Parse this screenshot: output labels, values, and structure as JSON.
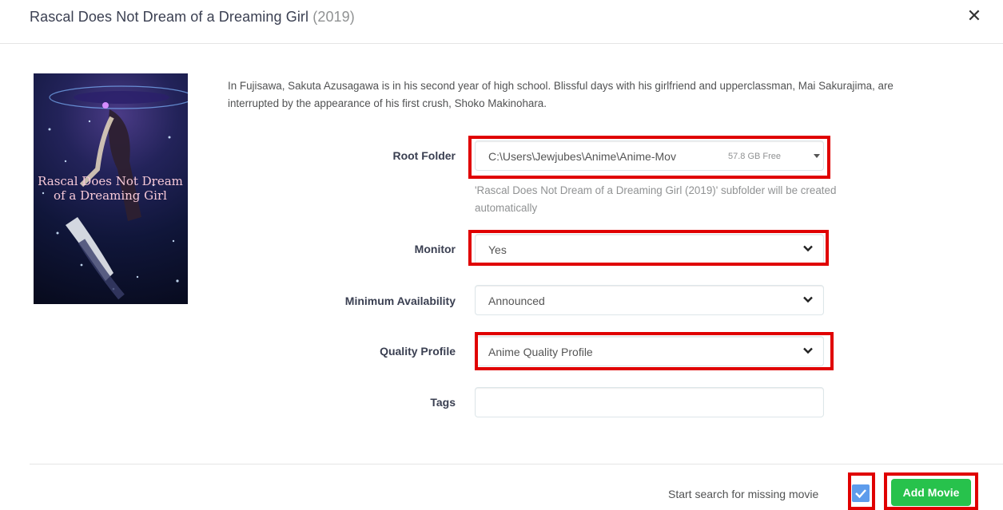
{
  "modal": {
    "title": "Rascal Does Not Dream of a Dreaming Girl",
    "year": "(2019)",
    "close_icon": "close-icon"
  },
  "poster": {
    "alt_title_art": "Rascal Does Not Dream of a Dreaming Girl"
  },
  "overview": "In Fujisawa, Sakuta Azusagawa is in his second year of high school. Blissful days with his girlfriend and upperclassman, Mai Sakurajima, are interrupted by the appearance of his first crush, Shoko Makinohara.",
  "form": {
    "root_folder": {
      "label": "Root Folder",
      "value": "C:\\Users\\Jewjubes\\Anime\\Anime-Mov",
      "free_space": "57.8 GB Free",
      "help": "'Rascal Does Not Dream of a Dreaming Girl (2019)' subfolder will be created automatically"
    },
    "monitor": {
      "label": "Monitor",
      "value": "Yes"
    },
    "minimum_availability": {
      "label": "Minimum Availability",
      "value": "Announced"
    },
    "quality_profile": {
      "label": "Quality Profile",
      "value": "Anime Quality Profile"
    },
    "tags": {
      "label": "Tags",
      "value": ""
    }
  },
  "footer": {
    "search_label": "Start search for missing movie",
    "search_checked": true,
    "add_button": "Add Movie"
  },
  "colors": {
    "highlight": "#e00000",
    "add_button": "#27c24c",
    "checkbox": "#5d9cec"
  }
}
